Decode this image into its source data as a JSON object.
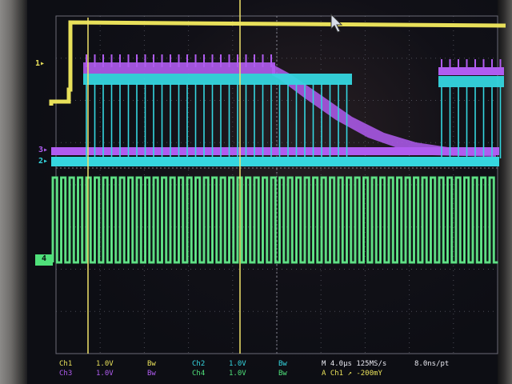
{
  "channel_markers": {
    "ch1": "1",
    "ch2": "2",
    "ch3": "3",
    "ch4": "4"
  },
  "readouts": {
    "ch1_label": "Ch1",
    "ch1_scale": "1.0V",
    "ch1_bw": "Bw",
    "ch2_label": "Ch2",
    "ch2_scale": "1.0V",
    "ch2_bw": "Bw",
    "ch3_label": "Ch3",
    "ch3_scale": "1.0V",
    "ch3_bw": "Bw",
    "ch4_label": "Ch4",
    "ch4_scale": "1.0V",
    "ch4_bw": "Bw",
    "timebase": "M 4.0µs 125MS/s",
    "resolution": "8.0ns/pt",
    "trigger": "A Ch1 ↗ -200mY"
  },
  "colors": {
    "ch1": "#e8e05a",
    "ch2": "#35d6df",
    "ch3": "#b05cf0",
    "ch4": "#4fe07a",
    "grid": "#5a5a66",
    "cursor": "#f0e26a",
    "readout_white": "#e8e8f0"
  },
  "icons": {
    "pointer": "mouse-pointer-icon"
  }
}
